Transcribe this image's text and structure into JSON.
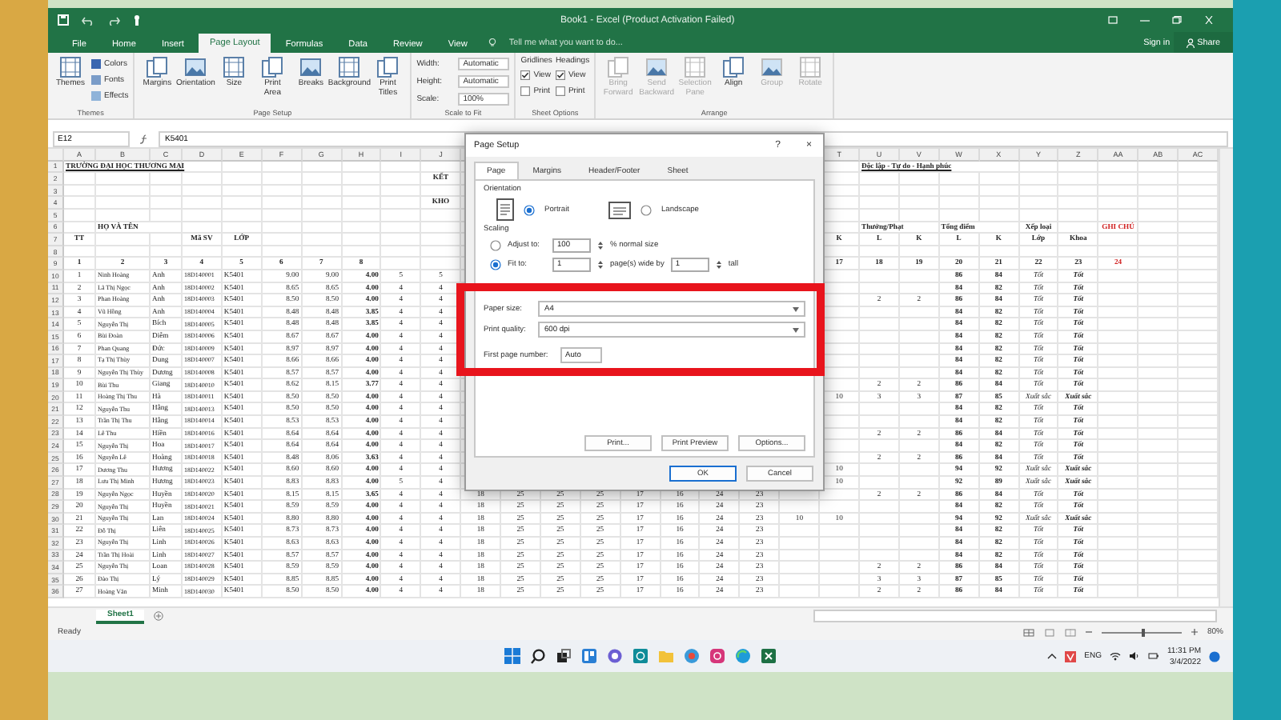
{
  "window": {
    "title": "Book1 - Excel (Product Activation Failed)",
    "sign_in": "Sign in",
    "share": "Share"
  },
  "tabs": [
    {
      "label": "File",
      "selected": false
    },
    {
      "label": "Home",
      "selected": false
    },
    {
      "label": "Insert",
      "selected": false
    },
    {
      "label": "Page Layout",
      "selected": true
    },
    {
      "label": "Formulas",
      "selected": false
    },
    {
      "label": "Data",
      "selected": false
    },
    {
      "label": "Review",
      "selected": false
    },
    {
      "label": "View",
      "selected": false
    }
  ],
  "tell_me": {
    "placeholder": "Tell me what you want to do..."
  },
  "ribbon": [
    {
      "label": "Themes",
      "columns": [
        {
          "kind": "large",
          "label": "Themes",
          "disabled": false
        },
        {
          "kind": "stack",
          "items": [
            {
              "label": "Colors"
            },
            {
              "label": "Fonts"
            },
            {
              "label": "Effects"
            }
          ]
        }
      ]
    },
    {
      "label": "Page Setup",
      "columns": [
        {
          "kind": "large",
          "label": "Margins",
          "disabled": false
        },
        {
          "kind": "large",
          "label": "Orientation",
          "disabled": false
        },
        {
          "kind": "large",
          "label": "Size",
          "disabled": false
        },
        {
          "kind": "large",
          "label": "Print Area",
          "disabled": false
        },
        {
          "kind": "large",
          "label": "Breaks",
          "disabled": false
        },
        {
          "kind": "large",
          "label": "Background",
          "disabled": false
        },
        {
          "kind": "large",
          "label": "Print Titles",
          "disabled": false
        }
      ]
    },
    {
      "label": "Scale to Fit",
      "columns": [
        {
          "kind": "fields",
          "items": [
            {
              "label": "Width:",
              "value": "Automatic"
            },
            {
              "label": "Height:",
              "value": "Automatic"
            },
            {
              "label": "Scale:",
              "value": "100%"
            }
          ]
        }
      ]
    },
    {
      "label": "Sheet Options",
      "columns": [
        {
          "kind": "options",
          "title": "Gridlines",
          "items": [
            {
              "label": "View",
              "checked": true
            },
            {
              "label": "Print",
              "checked": false
            }
          ]
        },
        {
          "kind": "options",
          "title": "Headings",
          "items": [
            {
              "label": "View",
              "checked": true
            },
            {
              "label": "Print",
              "checked": false
            }
          ]
        }
      ]
    },
    {
      "label": "Arrange",
      "columns": [
        {
          "kind": "large",
          "label": "Bring Forward",
          "disabled": true
        },
        {
          "kind": "large",
          "label": "Send Backward",
          "disabled": true
        },
        {
          "kind": "large",
          "label": "Selection Pane",
          "disabled": true
        },
        {
          "kind": "large",
          "label": "Align",
          "disabled": false
        },
        {
          "kind": "large",
          "label": "Group",
          "disabled": true
        },
        {
          "kind": "large",
          "label": "Rotate",
          "disabled": true
        }
      ]
    }
  ],
  "formula_bar": {
    "name_box": "E12",
    "formula": "K5401"
  },
  "sheet": {
    "columns": [
      "A",
      "B",
      "C",
      "D",
      "E",
      "F",
      "G",
      "H",
      "I",
      "J",
      null,
      null,
      null,
      null,
      null,
      null,
      null,
      null,
      null,
      "T",
      "U",
      "V",
      "W",
      "X",
      "Y",
      "Z",
      "AA",
      "AB",
      "AC"
    ],
    "rows": [
      {
        "n": "1",
        "cells": [
          "TRƯỜNG ĐẠI HỌC THƯƠNG MẠI",
          null,
          null,
          null,
          null,
          null,
          null,
          null,
          null,
          null,
          null,
          null,
          null,
          null,
          null,
          null,
          null,
          null,
          null,
          null,
          "Độc lập - Tự do - Hạnh phúc",
          null,
          null,
          null,
          null,
          null,
          null,
          null,
          null
        ]
      },
      {
        "n": "2",
        "cells": [
          null,
          null,
          null,
          null,
          null,
          null,
          null,
          null,
          null,
          "KẾT",
          null,
          null,
          null,
          null,
          null,
          null,
          null,
          null,
          null,
          null,
          null,
          null,
          null,
          null,
          null,
          null,
          null,
          null,
          null
        ]
      },
      {
        "n": "3",
        "cells": [
          null,
          null,
          null,
          null,
          null,
          null,
          null,
          null,
          null,
          null,
          null,
          null,
          null,
          null,
          null,
          null,
          null,
          null,
          null,
          null,
          null,
          null,
          null,
          null,
          null,
          null,
          null,
          null,
          null
        ]
      },
      {
        "n": "4",
        "cells": [
          null,
          null,
          null,
          null,
          null,
          null,
          null,
          null,
          null,
          "KHO",
          null,
          null,
          null,
          null,
          null,
          null,
          null,
          null,
          null,
          null,
          null,
          null,
          null,
          null,
          null,
          null,
          null,
          null,
          null
        ]
      },
      {
        "n": "5",
        "cells": [
          null,
          null,
          null,
          null,
          null,
          null,
          null,
          null,
          null,
          null,
          null,
          null,
          null,
          null,
          null,
          null,
          null,
          null,
          null,
          null,
          null,
          null,
          null,
          null,
          null,
          null,
          null,
          null,
          null
        ]
      },
      {
        "n": "6",
        "cells": [
          null,
          "HỌ VÀ TÊN",
          null,
          null,
          null,
          null,
          null,
          null,
          null,
          null,
          null,
          null,
          null,
          null,
          null,
          null,
          null,
          null,
          null,
          null,
          "Thưởng/Phạt",
          null,
          "Tổng điểm",
          null,
          "Xếp loại",
          null,
          "GHI CHÚ",
          null,
          null
        ]
      },
      {
        "n": "7",
        "cells": [
          "TT",
          null,
          null,
          "Mã SV",
          "LỚP",
          null,
          null,
          null,
          null,
          null,
          null,
          null,
          null,
          null,
          null,
          null,
          null,
          null,
          null,
          "K",
          "L",
          "K",
          "L",
          "K",
          "Lớp",
          "Khoa",
          null,
          null,
          null
        ]
      },
      {
        "n": "8",
        "cells": [
          null,
          null,
          null,
          null,
          null,
          null,
          null,
          null,
          null,
          null,
          null,
          null,
          null,
          null,
          null,
          null,
          null,
          null,
          null,
          null,
          null,
          null,
          null,
          null,
          null,
          null,
          null,
          null,
          null
        ]
      },
      {
        "n": "9",
        "cells": [
          "1",
          "2",
          "3",
          "4",
          "5",
          "6",
          "7",
          "8",
          null,
          null,
          null,
          null,
          null,
          null,
          null,
          null,
          null,
          null,
          null,
          "17",
          "18",
          "19",
          "20",
          "21",
          "22",
          "23",
          "24",
          null,
          null
        ]
      },
      {
        "n": "10",
        "cells": [
          "1",
          "Ninh Hoàng",
          "Anh",
          "18D140001",
          "K5401",
          "9.00",
          "9.00",
          "4.00",
          "5",
          "5",
          null,
          null,
          null,
          null,
          null,
          null,
          null,
          null,
          null,
          null,
          null,
          null,
          "86",
          "84",
          "Tốt",
          "Tốt",
          null,
          null,
          null
        ]
      },
      {
        "n": "11",
        "cells": [
          "2",
          "Lã Thị Ngọc",
          "Anh",
          "18D140002",
          "K5401",
          "8.65",
          "8.65",
          "4.00",
          "4",
          "4",
          null,
          null,
          null,
          null,
          null,
          null,
          null,
          null,
          null,
          null,
          null,
          null,
          "84",
          "82",
          "Tốt",
          "Tốt",
          null,
          null,
          null
        ]
      },
      {
        "n": "12",
        "cells": [
          "3",
          "Phan Hoàng",
          "Anh",
          "18D140003",
          "K5401",
          "8.50",
          "8.50",
          "4.00",
          "4",
          "4",
          null,
          null,
          null,
          null,
          null,
          null,
          null,
          null,
          null,
          null,
          "2",
          "2",
          "86",
          "84",
          "Tốt",
          "Tốt",
          null,
          null,
          null
        ]
      },
      {
        "n": "13",
        "cells": [
          "4",
          "Vũ Hồng",
          "Anh",
          "18D140004",
          "K5401",
          "8.48",
          "8.48",
          "3.85",
          "4",
          "4",
          null,
          null,
          null,
          null,
          null,
          null,
          null,
          null,
          null,
          null,
          null,
          null,
          "84",
          "82",
          "Tốt",
          "Tốt",
          null,
          null,
          null
        ]
      },
      {
        "n": "14",
        "cells": [
          "5",
          "Nguyễn Thị",
          "Bích",
          "18D140005",
          "K5401",
          "8.48",
          "8.48",
          "3.85",
          "4",
          "4",
          null,
          null,
          null,
          null,
          null,
          null,
          null,
          null,
          null,
          null,
          null,
          null,
          "84",
          "82",
          "Tốt",
          "Tốt",
          null,
          null,
          null
        ]
      },
      {
        "n": "15",
        "cells": [
          "6",
          "Bùi Đoàn",
          "Diễm",
          "18D140006",
          "K5401",
          "8.67",
          "8.67",
          "4.00",
          "4",
          "4",
          null,
          null,
          null,
          null,
          null,
          null,
          null,
          null,
          null,
          null,
          null,
          null,
          "84",
          "82",
          "Tốt",
          "Tốt",
          null,
          null,
          null
        ]
      },
      {
        "n": "16",
        "cells": [
          "7",
          "Phan Quang",
          "Đức",
          "18D140009",
          "K5401",
          "8.97",
          "8.97",
          "4.00",
          "4",
          "4",
          null,
          null,
          null,
          null,
          null,
          null,
          null,
          null,
          null,
          null,
          null,
          null,
          "84",
          "82",
          "Tốt",
          "Tốt",
          null,
          null,
          null
        ]
      },
      {
        "n": "17",
        "cells": [
          "8",
          "Tạ Thị Thùy",
          "Dung",
          "18D140007",
          "K5401",
          "8.66",
          "8.66",
          "4.00",
          "4",
          "4",
          null,
          null,
          null,
          null,
          null,
          null,
          null,
          null,
          null,
          null,
          null,
          null,
          "84",
          "82",
          "Tốt",
          "Tốt",
          null,
          null,
          null
        ]
      },
      {
        "n": "18",
        "cells": [
          "9",
          "Nguyễn Thị Thùy",
          "Dương",
          "18D140008",
          "K5401",
          "8.57",
          "8.57",
          "4.00",
          "4",
          "4",
          null,
          null,
          null,
          null,
          null,
          null,
          null,
          null,
          null,
          null,
          null,
          null,
          "84",
          "82",
          "Tốt",
          "Tốt",
          null,
          null,
          null
        ]
      },
      {
        "n": "19",
        "cells": [
          "10",
          "Bùi Thu",
          "Giang",
          "18D140010",
          "K5401",
          "8.62",
          "8.15",
          "3.77",
          "4",
          "4",
          null,
          null,
          null,
          null,
          null,
          null,
          null,
          null,
          null,
          null,
          "2",
          "2",
          "86",
          "84",
          "Tốt",
          "Tốt",
          null,
          null,
          null
        ]
      },
      {
        "n": "20",
        "cells": [
          "11",
          "Hoàng Thị Thu",
          "Hà",
          "18D140011",
          "K5401",
          "8.50",
          "8.50",
          "4.00",
          "4",
          "4",
          null,
          null,
          null,
          null,
          null,
          null,
          null,
          null,
          null,
          "10",
          "3",
          "3",
          "87",
          "85",
          "Xuất sắc",
          "Xuất sắc",
          null,
          null,
          null
        ]
      },
      {
        "n": "21",
        "cells": [
          "12",
          "Nguyễn Thu",
          "Hằng",
          "18D140013",
          "K5401",
          "8.50",
          "8.50",
          "4.00",
          "4",
          "4",
          null,
          null,
          null,
          null,
          null,
          null,
          null,
          null,
          null,
          null,
          null,
          null,
          "84",
          "82",
          "Tốt",
          "Tốt",
          null,
          null,
          null
        ]
      },
      {
        "n": "22",
        "cells": [
          "13",
          "Trần Thị Thu",
          "Hằng",
          "18D140014",
          "K5401",
          "8.53",
          "8.53",
          "4.00",
          "4",
          "4",
          null,
          null,
          null,
          null,
          null,
          null,
          null,
          null,
          null,
          null,
          null,
          null,
          "84",
          "82",
          "Tốt",
          "Tốt",
          null,
          null,
          null
        ]
      },
      {
        "n": "23",
        "cells": [
          "14",
          "Lê Thu",
          "Hiền",
          "18D140016",
          "K5401",
          "8.64",
          "8.64",
          "4.00",
          "4",
          "4",
          null,
          null,
          null,
          null,
          null,
          null,
          null,
          null,
          null,
          null,
          "2",
          "2",
          "86",
          "84",
          "Tốt",
          "Tốt",
          null,
          null,
          null
        ]
      },
      {
        "n": "24",
        "cells": [
          "15",
          "Nguyễn Thị",
          "Hoa",
          "18D140017",
          "K5401",
          "8.64",
          "8.64",
          "4.00",
          "4",
          "4",
          null,
          null,
          null,
          null,
          null,
          null,
          null,
          null,
          null,
          null,
          null,
          null,
          "84",
          "82",
          "Tốt",
          "Tốt",
          null,
          null,
          null
        ]
      },
      {
        "n": "25",
        "cells": [
          "16",
          "Nguyễn Lê",
          "Hoàng",
          "18D140018",
          "K5401",
          "8.48",
          "8.06",
          "3.63",
          "4",
          "4",
          null,
          null,
          null,
          null,
          null,
          null,
          null,
          null,
          null,
          null,
          "2",
          "2",
          "86",
          "84",
          "Tốt",
          "Tốt",
          null,
          null,
          null
        ]
      },
      {
        "n": "26",
        "cells": [
          "17",
          "Dương Thu",
          "Hương",
          "18D140022",
          "K5401",
          "8.60",
          "8.60",
          "4.00",
          "4",
          "4",
          null,
          null,
          null,
          null,
          null,
          null,
          null,
          null,
          null,
          "10",
          null,
          null,
          "94",
          "92",
          "Xuất sắc",
          "Xuất sắc",
          null,
          null,
          null
        ]
      },
      {
        "n": "27",
        "cells": [
          "18",
          "Lưu Thị Minh",
          "Hương",
          "18D140023",
          "K5401",
          "8.83",
          "8.83",
          "4.00",
          "5",
          "4",
          null,
          null,
          null,
          null,
          null,
          null,
          null,
          null,
          null,
          "10",
          null,
          null,
          "92",
          "89",
          "Xuất sắc",
          "Xuất sắc",
          null,
          null,
          null
        ]
      },
      {
        "n": "28",
        "cells": [
          "19",
          "Nguyễn Ngọc",
          "Huyền",
          "18D140020",
          "K5401",
          "8.15",
          "8.15",
          "3.65",
          "4",
          "4",
          "18",
          "25",
          "25",
          "25",
          "17",
          "16",
          "24",
          "23",
          null,
          null,
          "2",
          "2",
          "86",
          "84",
          "Tốt",
          "Tốt",
          null,
          null,
          null
        ]
      },
      {
        "n": "29",
        "cells": [
          "20",
          "Nguyễn Thị",
          "Huyền",
          "18D140021",
          "K5401",
          "8.59",
          "8.59",
          "4.00",
          "4",
          "4",
          "18",
          "25",
          "25",
          "25",
          "17",
          "16",
          "24",
          "23",
          null,
          null,
          null,
          null,
          "84",
          "82",
          "Tốt",
          "Tốt",
          null,
          null,
          null
        ]
      },
      {
        "n": "30",
        "cells": [
          "21",
          "Nguyễn Thị",
          "Lan",
          "18D140024",
          "K5401",
          "8.80",
          "8.80",
          "4.00",
          "4",
          "4",
          "18",
          "25",
          "25",
          "25",
          "17",
          "16",
          "24",
          "23",
          "10",
          "10",
          null,
          null,
          "94",
          "92",
          "Xuất sắc",
          "Xuất sắc",
          null,
          null,
          null
        ]
      },
      {
        "n": "31",
        "cells": [
          "22",
          "Đỗ Thị",
          "Liên",
          "18D140025",
          "K5401",
          "8.73",
          "8.73",
          "4.00",
          "4",
          "4",
          "18",
          "25",
          "25",
          "25",
          "17",
          "16",
          "24",
          "23",
          null,
          null,
          null,
          null,
          "84",
          "82",
          "Tốt",
          "Tốt",
          null,
          null,
          null
        ]
      },
      {
        "n": "32",
        "cells": [
          "23",
          "Nguyễn Thị",
          "Linh",
          "18D140026",
          "K5401",
          "8.63",
          "8.63",
          "4.00",
          "4",
          "4",
          "18",
          "25",
          "25",
          "25",
          "17",
          "16",
          "24",
          "23",
          null,
          null,
          null,
          null,
          "84",
          "82",
          "Tốt",
          "Tốt",
          null,
          null,
          null
        ]
      },
      {
        "n": "33",
        "cells": [
          "24",
          "Trần Thị Hoài",
          "Linh",
          "18D140027",
          "K5401",
          "8.57",
          "8.57",
          "4.00",
          "4",
          "4",
          "18",
          "25",
          "25",
          "25",
          "17",
          "16",
          "24",
          "23",
          null,
          null,
          null,
          null,
          "84",
          "82",
          "Tốt",
          "Tốt",
          null,
          null,
          null
        ]
      },
      {
        "n": "34",
        "cells": [
          "25",
          "Nguyễn Thị",
          "Loan",
          "18D140028",
          "K5401",
          "8.59",
          "8.59",
          "4.00",
          "4",
          "4",
          "18",
          "25",
          "25",
          "25",
          "17",
          "16",
          "24",
          "23",
          null,
          null,
          "2",
          "2",
          "86",
          "84",
          "Tốt",
          "Tốt",
          null,
          null,
          null
        ]
      },
      {
        "n": "35",
        "cells": [
          "26",
          "Đào Thị",
          "Lý",
          "18D140029",
          "K5401",
          "8.85",
          "8.85",
          "4.00",
          "4",
          "4",
          "18",
          "25",
          "25",
          "25",
          "17",
          "16",
          "24",
          "23",
          null,
          null,
          "3",
          "3",
          "87",
          "85",
          "Tốt",
          "Tốt",
          null,
          null,
          null
        ]
      },
      {
        "n": "36",
        "cells": [
          "27",
          "Hoàng Văn",
          "Minh",
          "18D140030",
          "K5401",
          "8.50",
          "8.50",
          "4.00",
          "4",
          "4",
          "18",
          "25",
          "25",
          "25",
          "17",
          "16",
          "24",
          "23",
          null,
          null,
          "2",
          "2",
          "86",
          "84",
          "Tốt",
          "Tốt",
          null,
          null,
          null
        ]
      }
    ]
  },
  "sheet_tabs": [
    {
      "label": "Sheet1",
      "selected": true
    }
  ],
  "status_bar": {
    "status": "Ready",
    "zoom": "80%",
    "zoom_slider": {
      "level": 0.5
    }
  },
  "dialog": {
    "title": "Page Setup",
    "help": "?",
    "close": "×",
    "tabs": [
      {
        "label": "Page",
        "selected": true
      },
      {
        "label": "Margins",
        "selected": false
      },
      {
        "label": "Header/Footer",
        "selected": false
      },
      {
        "label": "Sheet",
        "selected": false
      }
    ],
    "orientation": {
      "label": "Orientation",
      "options": [
        {
          "label": "Portrait",
          "selected": true
        },
        {
          "label": "Landscape",
          "selected": false
        }
      ]
    },
    "scaling": {
      "label": "Scaling",
      "adjust": {
        "label": "Adjust to:",
        "value": "100",
        "suffix": "% normal size",
        "selected": false
      },
      "fit": {
        "label": "Fit to:",
        "wide": "1",
        "wide_suffix": "page(s) wide by",
        "tall": "1",
        "tall_suffix": "tall",
        "selected": true
      }
    },
    "paper_size": {
      "label": "Paper size:",
      "value": "A4"
    },
    "print_quality": {
      "label": "Print quality:",
      "value": "600 dpi"
    },
    "first_page_number": {
      "label": "First page number:",
      "value": "Auto"
    },
    "buttons": [
      "Print...",
      "Print Preview",
      "Options..."
    ],
    "footer_buttons": [
      {
        "label": "OK",
        "default": true
      },
      {
        "label": "Cancel",
        "default": false
      }
    ]
  },
  "taskbar": {
    "language": "ENG",
    "time": "11:31 PM",
    "date": "3/4/2022"
  }
}
